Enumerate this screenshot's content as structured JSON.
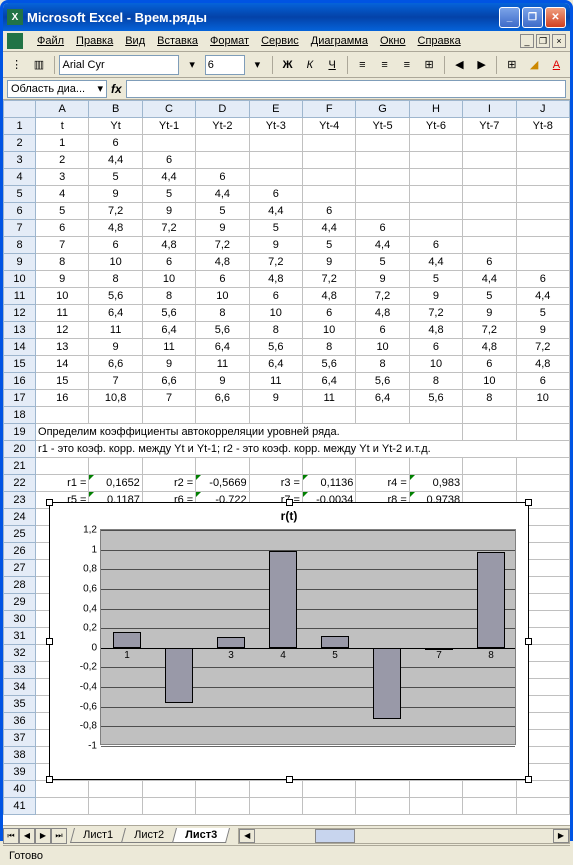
{
  "titlebar": {
    "title": "Microsoft Excel - Врем.ряды"
  },
  "menu": [
    "Файл",
    "Правка",
    "Вид",
    "Вставка",
    "Формат",
    "Сервис",
    "Диаграмма",
    "Окно",
    "Справка"
  ],
  "toolbar": {
    "fontname": "Arial Cyr",
    "fontsize": "6"
  },
  "namebox": "Область диа...",
  "colheaders": [
    "A",
    "B",
    "C",
    "D",
    "E",
    "F",
    "G",
    "H",
    "I",
    "J"
  ],
  "rows": [
    {
      "n": "1",
      "cells": [
        "t",
        "Yt",
        "Yt-1",
        "Yt-2",
        "Yt-3",
        "Yt-4",
        "Yt-5",
        "Yt-6",
        "Yt-7",
        "Yt-8"
      ]
    },
    {
      "n": "2",
      "cells": [
        "1",
        "6",
        "",
        "",
        "",
        "",
        "",
        "",
        "",
        ""
      ]
    },
    {
      "n": "3",
      "cells": [
        "2",
        "4,4",
        "6",
        "",
        "",
        "",
        "",
        "",
        "",
        ""
      ]
    },
    {
      "n": "4",
      "cells": [
        "3",
        "5",
        "4,4",
        "6",
        "",
        "",
        "",
        "",
        "",
        ""
      ]
    },
    {
      "n": "5",
      "cells": [
        "4",
        "9",
        "5",
        "4,4",
        "6",
        "",
        "",
        "",
        "",
        ""
      ]
    },
    {
      "n": "6",
      "cells": [
        "5",
        "7,2",
        "9",
        "5",
        "4,4",
        "6",
        "",
        "",
        "",
        ""
      ]
    },
    {
      "n": "7",
      "cells": [
        "6",
        "4,8",
        "7,2",
        "9",
        "5",
        "4,4",
        "6",
        "",
        "",
        ""
      ]
    },
    {
      "n": "8",
      "cells": [
        "7",
        "6",
        "4,8",
        "7,2",
        "9",
        "5",
        "4,4",
        "6",
        "",
        ""
      ]
    },
    {
      "n": "9",
      "cells": [
        "8",
        "10",
        "6",
        "4,8",
        "7,2",
        "9",
        "5",
        "4,4",
        "6",
        ""
      ]
    },
    {
      "n": "10",
      "cells": [
        "9",
        "8",
        "10",
        "6",
        "4,8",
        "7,2",
        "9",
        "5",
        "4,4",
        "6"
      ]
    },
    {
      "n": "11",
      "cells": [
        "10",
        "5,6",
        "8",
        "10",
        "6",
        "4,8",
        "7,2",
        "9",
        "5",
        "4,4"
      ]
    },
    {
      "n": "12",
      "cells": [
        "11",
        "6,4",
        "5,6",
        "8",
        "10",
        "6",
        "4,8",
        "7,2",
        "9",
        "5"
      ]
    },
    {
      "n": "13",
      "cells": [
        "12",
        "11",
        "6,4",
        "5,6",
        "8",
        "10",
        "6",
        "4,8",
        "7,2",
        "9"
      ]
    },
    {
      "n": "14",
      "cells": [
        "13",
        "9",
        "11",
        "6,4",
        "5,6",
        "8",
        "10",
        "6",
        "4,8",
        "7,2"
      ]
    },
    {
      "n": "15",
      "cells": [
        "14",
        "6,6",
        "9",
        "11",
        "6,4",
        "5,6",
        "8",
        "10",
        "6",
        "4,8"
      ]
    },
    {
      "n": "16",
      "cells": [
        "15",
        "7",
        "6,6",
        "9",
        "11",
        "6,4",
        "5,6",
        "8",
        "10",
        "6"
      ]
    },
    {
      "n": "17",
      "cells": [
        "16",
        "10,8",
        "7",
        "6,6",
        "9",
        "11",
        "6,4",
        "5,6",
        "8",
        "10"
      ]
    },
    {
      "n": "18",
      "cells": [
        "",
        "",
        "",
        "",
        "",
        "",
        "",
        "",
        "",
        ""
      ]
    },
    {
      "n": "19",
      "cells": [
        "Определим коэффициенты автокорреляции уровней ряда.",
        "",
        "",
        "",
        "",
        "",
        "",
        "",
        "",
        ""
      ],
      "left": true,
      "span": 8
    },
    {
      "n": "20",
      "cells": [
        "r1 - это коэф. корр. между Yt и Yt-1; r2 - это коэф. корр. между Yt и Yt-2 и.т.д.",
        "",
        "",
        "",
        "",
        "",
        "",
        "",
        "",
        ""
      ],
      "left": true,
      "span": 10
    },
    {
      "n": "21",
      "cells": [
        "",
        "",
        "",
        "",
        "",
        "",
        "",
        "",
        "",
        ""
      ]
    },
    {
      "n": "22",
      "cells": [
        "r1 =",
        "0,1652",
        "r2 =",
        "-0,5669",
        "r3 =",
        "0,1136",
        "r4 =",
        "0,983",
        "",
        ""
      ],
      "coef": true
    },
    {
      "n": "23",
      "cells": [
        "r5 =",
        "0,1187",
        "r6 =",
        "-0,722",
        "r7 =",
        "-0,0034",
        "r8 =",
        "0,9738",
        "",
        ""
      ],
      "coef": true
    },
    {
      "n": "24",
      "cells": [
        "",
        "",
        "",
        "",
        "",
        "",
        "",
        "",
        "",
        ""
      ]
    }
  ],
  "extraRows": [
    "25",
    "26",
    "27",
    "28",
    "29",
    "30",
    "31",
    "32",
    "33",
    "34",
    "35",
    "36",
    "37",
    "38",
    "39",
    "40",
    "41"
  ],
  "chart_data": {
    "type": "bar",
    "title": "r(t)",
    "categories": [
      "1",
      "2",
      "3",
      "4",
      "5",
      "6",
      "7",
      "8"
    ],
    "values": [
      0.1652,
      -0.5669,
      0.1136,
      0.983,
      0.1187,
      -0.722,
      -0.0034,
      0.9738
    ],
    "ylim": [
      -1,
      1.2
    ],
    "yticks": [
      -1,
      -0.8,
      -0.6,
      -0.4,
      -0.2,
      0,
      0.2,
      0.4,
      0.6,
      0.8,
      1,
      1.2
    ]
  },
  "sheets": [
    "Лист1",
    "Лист2",
    "Лист3"
  ],
  "activeSheet": "Лист3",
  "status": "Готово"
}
